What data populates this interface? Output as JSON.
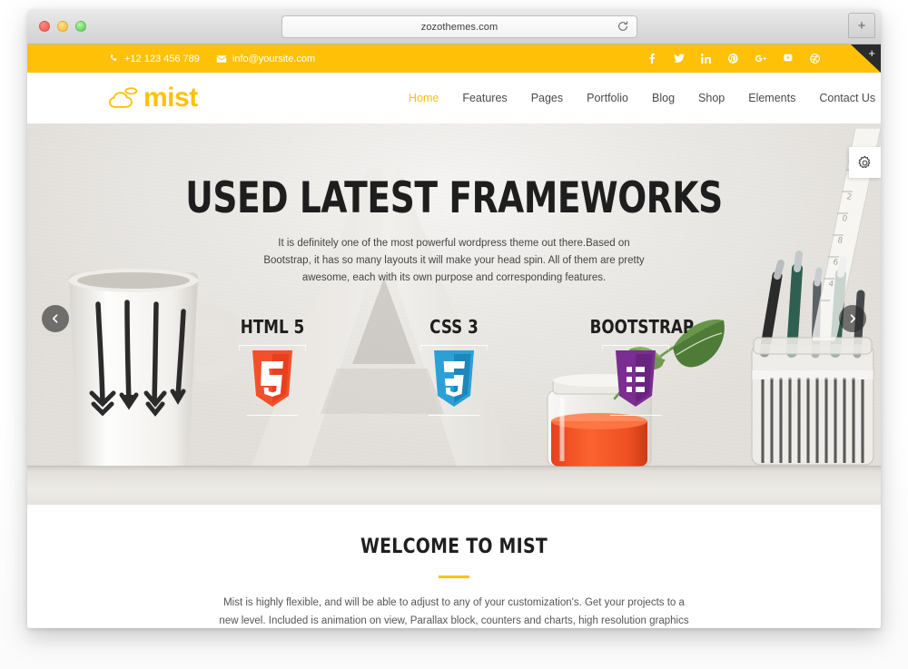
{
  "browser": {
    "url": "zozothemes.com",
    "reload_icon": "reload-icon",
    "newtab_label": "+",
    "traffic_lights": [
      "close",
      "minimize",
      "zoom"
    ]
  },
  "topbar": {
    "phone": "+12 123 456 789",
    "email": "info@yoursite.com",
    "phone_icon": "phone-icon",
    "email_icon": "envelope-icon",
    "corner_plus": "+",
    "social": [
      {
        "name": "facebook-icon",
        "label": "f"
      },
      {
        "name": "twitter-icon",
        "label": "t"
      },
      {
        "name": "linkedin-icon",
        "label": "in"
      },
      {
        "name": "pinterest-icon",
        "label": "p"
      },
      {
        "name": "google-plus-icon",
        "label": "g+"
      },
      {
        "name": "youtube-icon",
        "label": "yt"
      },
      {
        "name": "dribbble-icon",
        "label": "d"
      }
    ]
  },
  "header": {
    "logo_text": "mist",
    "logo_icon": "cloud-icon",
    "nav": [
      {
        "label": "Home",
        "active": true
      },
      {
        "label": "Features",
        "active": false
      },
      {
        "label": "Pages",
        "active": false
      },
      {
        "label": "Portfolio",
        "active": false
      },
      {
        "label": "Blog",
        "active": false
      },
      {
        "label": "Shop",
        "active": false
      },
      {
        "label": "Elements",
        "active": false
      },
      {
        "label": "Contact Us",
        "active": false
      }
    ],
    "cart_icon": "shopping-cart-icon",
    "search_icon": "search-icon"
  },
  "hero": {
    "title": "USED LATEST FRAMEWORKS",
    "description": "It is definitely one of the most powerful wordpress theme out there.Based on Bootstrap, it has so many layouts it will make your head spin. All of them are pretty awesome, each with its own purpose and corresponding features.",
    "tech": [
      {
        "label": "HTML 5",
        "icon": "html5-shield-icon",
        "color": "#F2502C"
      },
      {
        "label": "CSS 3",
        "icon": "css3-shield-icon",
        "color": "#2CA0D6"
      },
      {
        "label": "BOOTSTRAP",
        "icon": "bootstrap-shield-icon",
        "color": "#7B2D91"
      }
    ],
    "prev_arrow_icon": "chevron-left-icon",
    "next_arrow_icon": "chevron-right-icon",
    "settings_icon": "gear-icon"
  },
  "welcome": {
    "title": "WELCOME TO MIST",
    "description": "Mist is highly flexible, and will be able to adjust to any of your customization's. Get your projects to a new level. Included is animation on view, Parallax block, counters and charts, high resolution graphics etc."
  },
  "colors": {
    "accent_yellow": "#FFC107",
    "text_dark": "#1F1F1F",
    "html5": "#F2502C",
    "css3": "#2CA0D6",
    "bootstrap": "#7B2D91"
  }
}
